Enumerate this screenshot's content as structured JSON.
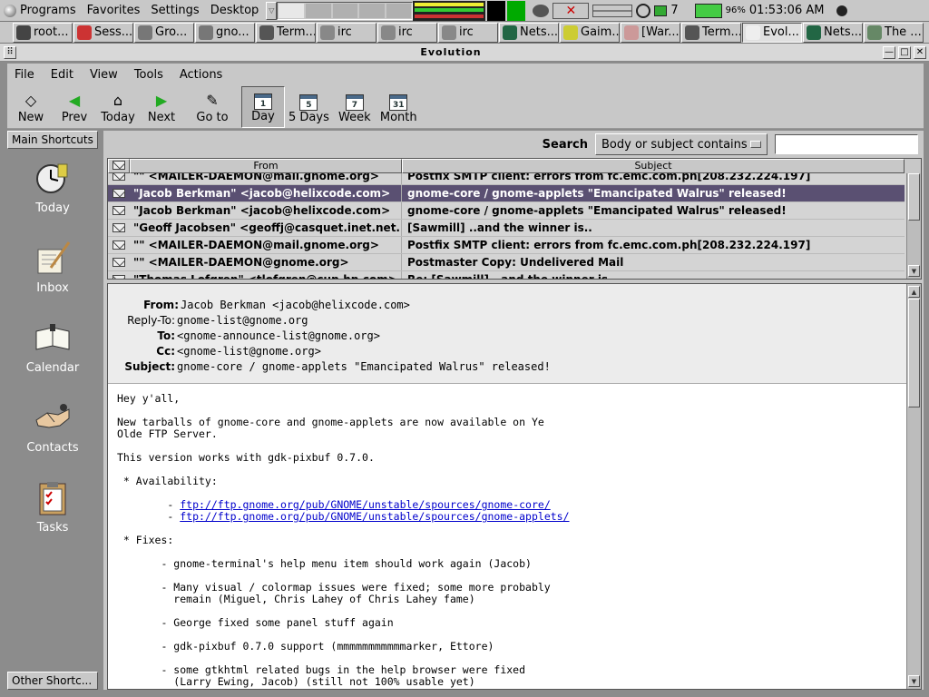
{
  "panel": {
    "menus": [
      "Programs",
      "Favorites",
      "Settings",
      "Desktop"
    ],
    "tray_number": "7",
    "battery": "96%",
    "clock": "01:53:06 AM"
  },
  "taskbar": [
    {
      "label": "root...",
      "color": "#444"
    },
    {
      "label": "Sess...",
      "color": "#c33"
    },
    {
      "label": "Gro...",
      "color": "#777"
    },
    {
      "label": "gno...",
      "color": "#777"
    },
    {
      "label": "Term...",
      "color": "#555"
    },
    {
      "label": "irc",
      "color": "#888"
    },
    {
      "label": "irc",
      "color": "#888"
    },
    {
      "label": "irc",
      "color": "#888"
    },
    {
      "label": "Nets...",
      "color": "#264"
    },
    {
      "label": "Gaim...",
      "color": "#cc3"
    },
    {
      "label": "[War...]",
      "color": "#c99"
    },
    {
      "label": "Term...",
      "color": "#555"
    },
    {
      "label": "Evol...",
      "color": "#eee"
    },
    {
      "label": "Nets...",
      "color": "#264"
    },
    {
      "label": "The ...",
      "color": "#686"
    }
  ],
  "window": {
    "title": "Evolution"
  },
  "menubar": [
    "File",
    "Edit",
    "View",
    "Tools",
    "Actions"
  ],
  "toolbar": {
    "new": "New",
    "prev": "Prev",
    "today": "Today",
    "next": "Next",
    "goto": "Go to",
    "day": "Day",
    "five_days": "5 Days",
    "week": "Week",
    "month": "Month",
    "day_num": "1",
    "five_num": "5",
    "week_num": "7",
    "month_num": "31"
  },
  "shortcuts": {
    "header": "Main Shortcuts",
    "footer": "Other Shortc...",
    "items": [
      "Today",
      "Inbox",
      "Calendar",
      "Contacts",
      "Tasks"
    ]
  },
  "search": {
    "label": "Search",
    "option": "Body or subject contains",
    "value": ""
  },
  "list": {
    "col_from": "From",
    "col_subject": "Subject",
    "rows": [
      {
        "from": "\"\" <MAILER-DAEMON@mail.gnome.org>",
        "subject": "Postfix SMTP client: errors from fc.emc.com.ph[208.232.224.197]"
      },
      {
        "from": "\"Jacob Berkman\" <jacob@helixcode.com>",
        "subject": "gnome-core / gnome-applets \"Emancipated Walrus\" released!"
      },
      {
        "from": "\"Jacob Berkman\" <jacob@helixcode.com>",
        "subject": "gnome-core / gnome-applets \"Emancipated Walrus\" released!"
      },
      {
        "from": "\"Geoff Jacobsen\" <geoffj@casquet.inet.net.nz>",
        "subject": "[Sawmill] ..and the winner is.."
      },
      {
        "from": "\"\" <MAILER-DAEMON@mail.gnome.org>",
        "subject": "Postfix SMTP client: errors from fc.emc.com.ph[208.232.224.197]"
      },
      {
        "from": "\"\" <MAILER-DAEMON@gnome.org>",
        "subject": "Postmaster Copy: Undelivered Mail"
      },
      {
        "from": "\"Thomas Lofgren\" <tlofgren@cup.hp.com>",
        "subject": "Re: [Sawmill] ..and the winner is.."
      }
    ]
  },
  "message": {
    "from_label": "From:",
    "from": "Jacob Berkman <jacob@helixcode.com>",
    "replyto_label": "Reply-To:",
    "replyto": "gnome-list@gnome.org",
    "to_label": "To:",
    "to": "<gnome-announce-list@gnome.org>",
    "cc_label": "Cc:",
    "cc": "<gnome-list@gnome.org>",
    "subject_label": "Subject:",
    "subject": "gnome-core / gnome-applets \"Emancipated Walrus\" released!",
    "greeting": "Hey y'all,",
    "p1a": "New tarballs of gnome-core and gnome-applets are now available on Ye",
    "p1b": "Olde FTP Server.",
    "p2": "This version works with gdk-pixbuf 0.7.0.",
    "avail": " * Availability:",
    "link1": "ftp://ftp.gnome.org/pub/GNOME/unstable/spources/gnome-core/",
    "link2": "ftp://ftp.gnome.org/pub/GNOME/unstable/spources/gnome-applets/",
    "fixes": " * Fixes:",
    "f1": "       - gnome-terminal's help menu item should work again (Jacob)",
    "f2a": "       - Many visual / colormap issues were fixed; some more probably",
    "f2b": "         remain (Miguel, Chris Lahey of Chris Lahey fame)",
    "f3": "       - George fixed some panel stuff again",
    "f4": "       - gdk-pixbuf 0.7.0 support (mmmmmmmmmmmarker, Ettore)",
    "f5a": "       - some gtkhtml related bugs in the help browser were fixed",
    "f5b": "         (Larry Ewing, Jacob) (still not 100% usable yet)"
  }
}
